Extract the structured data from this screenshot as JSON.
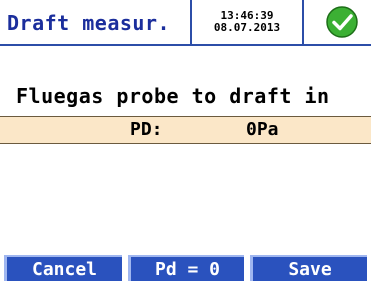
{
  "header": {
    "title": "Draft measur.",
    "time": "13:46:39",
    "date": "08.07.2013",
    "status_icon": "ok-check-icon",
    "status_color": "#3cb034"
  },
  "main": {
    "message": "Fluegas probe to draft in",
    "reading": {
      "label": "PD:",
      "value": "0Pa",
      "background": "#fbe7c8"
    }
  },
  "softkeys": {
    "left": "Cancel",
    "middle": "Pd = 0",
    "right": "Save",
    "color": "#2a52be"
  }
}
